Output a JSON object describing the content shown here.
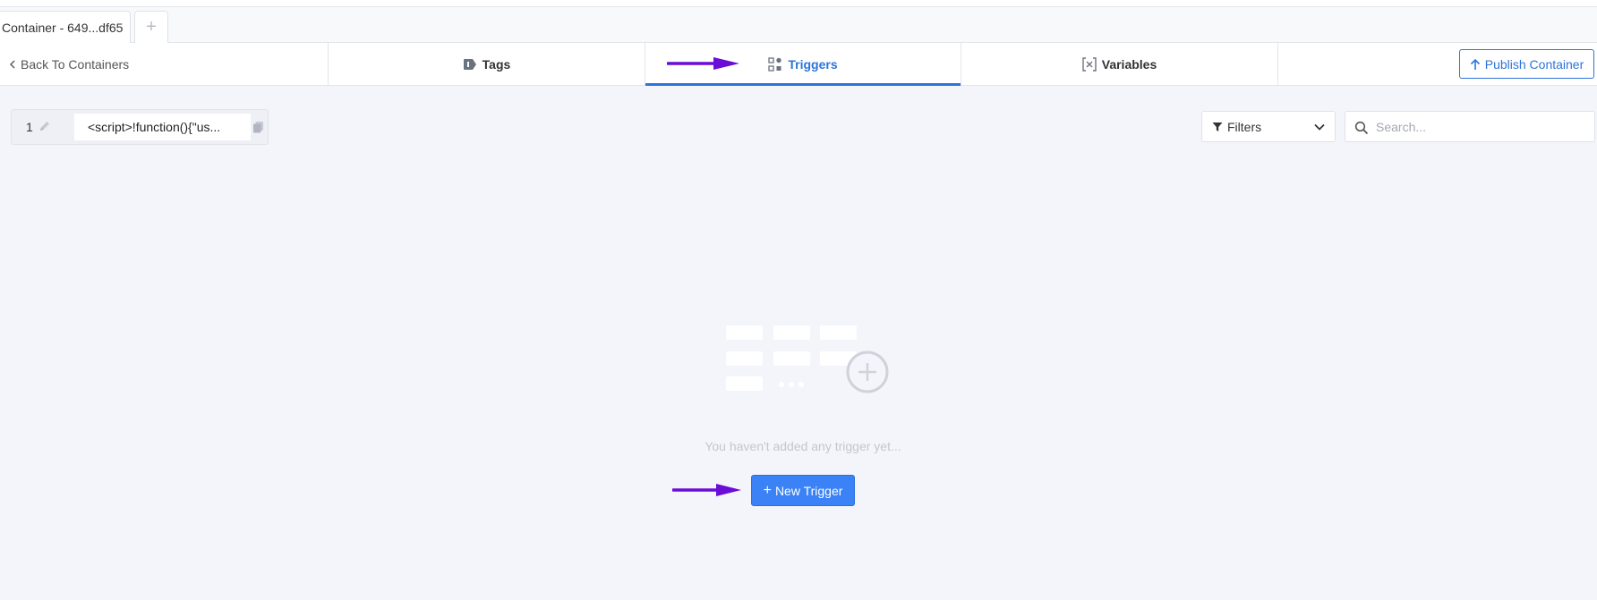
{
  "container_tab": {
    "label": "Container - 649...df65",
    "add_label": "+"
  },
  "nav": {
    "back_label": "Back To Containers",
    "tabs": [
      {
        "label": "Tags",
        "icon": "tag-icon",
        "active": false
      },
      {
        "label": "Triggers",
        "icon": "triggers-grid-icon",
        "active": true
      },
      {
        "label": "Variables",
        "icon": "variable-brackets-icon",
        "active": false
      }
    ],
    "publish_label": "Publish Container"
  },
  "code_snippet": {
    "number": "1",
    "value": "<script>!function(){\"us..."
  },
  "filters": {
    "label": "Filters"
  },
  "search": {
    "placeholder": "Search..."
  },
  "empty_state": {
    "message": "You haven't added any trigger yet...",
    "button_label": "New Trigger",
    "button_prefix": "+"
  },
  "colors": {
    "accent": "#2d74da",
    "button": "#3b82f6",
    "annotation_arrow": "#6a0dd6",
    "background": "#f4f5fa"
  }
}
